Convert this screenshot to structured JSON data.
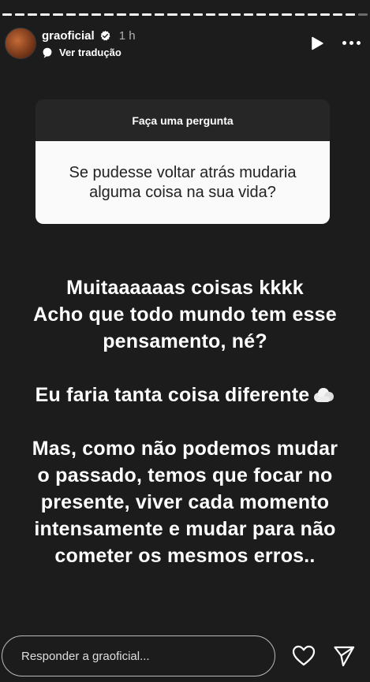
{
  "header": {
    "username": "graoficial",
    "time": "1 h",
    "translate_label": "Ver tradução"
  },
  "question": {
    "header": "Faça uma pergunta",
    "body": "Se pudesse voltar atrás mudaria alguma coisa na sua vida?"
  },
  "story": {
    "line1": "Muitaaaaaas coisas kkkk",
    "line2": "Acho que todo mundo tem esse",
    "line3": "pensamento, né?",
    "line4": "Eu faria tanta coisa diferente",
    "line5": "Mas, como não podemos mudar",
    "line6": "o passado, temos que focar no",
    "line7": "presente, viver cada momento",
    "line8": "intensamente e mudar para não",
    "line9": "cometer os mesmos erros.."
  },
  "reply": {
    "placeholder": "Responder a graoficial..."
  },
  "icons": {
    "verified": "verified-badge-icon",
    "translate": "translate-icon",
    "play": "play-icon",
    "more": "more-icon",
    "cloud": "cloud-emoji-icon",
    "like": "heart-icon",
    "send": "send-icon"
  }
}
